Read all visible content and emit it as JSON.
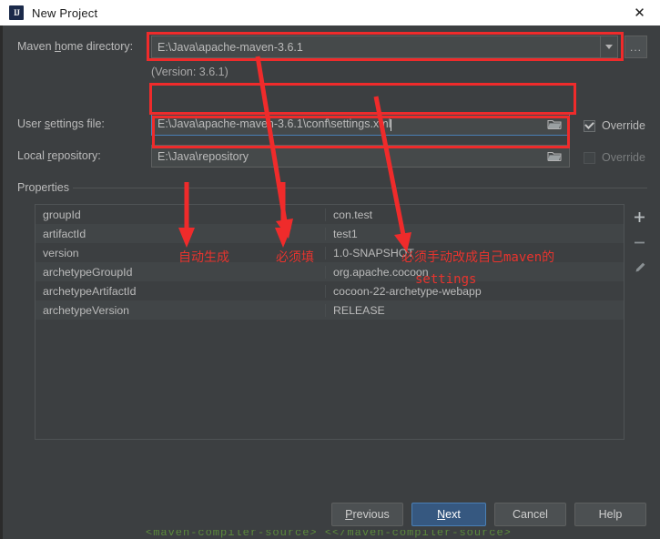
{
  "window": {
    "title": "New Project",
    "icon": "intellij-idea-icon",
    "icon_text": "IJ",
    "close_label": "✕"
  },
  "form": {
    "maven_home": {
      "label_pre": "Maven ",
      "label_accel": "h",
      "label_post": "ome directory:",
      "label_full": "Maven home directory:",
      "value": "E:\\Java\\apache-maven-3.6.1",
      "dropdown_icon": "chevron-down-icon",
      "browse_label": "..."
    },
    "version_note": "(Version: 3.6.1)",
    "user_settings": {
      "label_pre": "User ",
      "label_accel": "s",
      "label_post": "ettings file:",
      "label_full": "User settings file:",
      "value": "E:\\Java\\apache-maven-3.6.1\\conf\\settings.xml",
      "browse_icon": "folder-icon",
      "override_label": "Override",
      "override_checked": true
    },
    "local_repository": {
      "label_pre": "Local ",
      "label_accel": "r",
      "label_post": "epository:",
      "label_full": "Local repository:",
      "value": "E:\\Java\\repository",
      "browse_icon": "folder-icon",
      "override_label": "Override",
      "override_checked": false
    }
  },
  "properties": {
    "group_label": "Properties",
    "rows": [
      {
        "key": "groupId",
        "value": "con.test"
      },
      {
        "key": "artifactId",
        "value": "test1"
      },
      {
        "key": "version",
        "value": "1.0-SNAPSHOT"
      },
      {
        "key": "archetypeGroupId",
        "value": "org.apache.cocoon"
      },
      {
        "key": "archetypeArtifactId",
        "value": "cocoon-22-archetype-webapp"
      },
      {
        "key": "archetypeVersion",
        "value": "RELEASE"
      }
    ],
    "actions": [
      {
        "name": "add-property-button",
        "icon": "plus-icon"
      },
      {
        "name": "remove-property-button",
        "icon": "minus-icon"
      },
      {
        "name": "edit-property-button",
        "icon": "pencil-icon"
      }
    ]
  },
  "footer": {
    "previous": {
      "pre": "",
      "accel": "P",
      "post": "revious",
      "full": "Previous"
    },
    "next": {
      "pre": "",
      "accel": "N",
      "post": "ext",
      "full": "Next"
    },
    "cancel": {
      "full": "Cancel"
    },
    "help": {
      "full": "Help"
    }
  },
  "annotations": {
    "color": "#ef2b2b",
    "auto_generate": "自动生成",
    "must_fill": "必须填",
    "must_change_line1": "必须手动改成自己maven的",
    "must_change_line2": "settings"
  },
  "background_bleed": "<maven-compiler-source>  <</maven-compiler-source>"
}
